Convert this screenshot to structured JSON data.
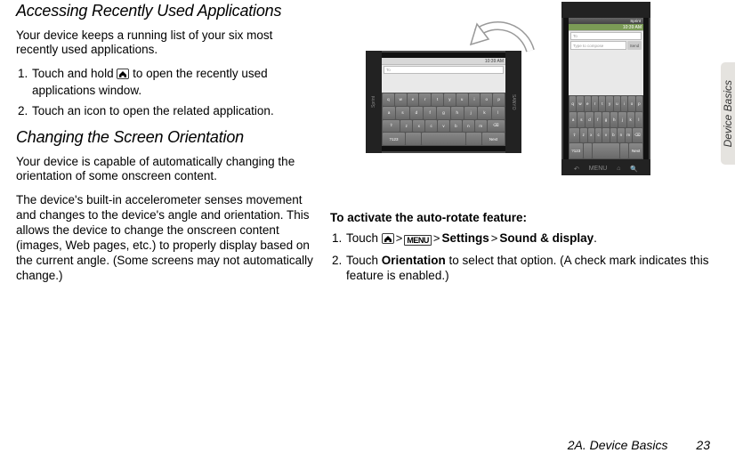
{
  "section1": {
    "title": "Accessing Recently Used Applications",
    "intro": "Your device keeps a running list of your six most recently used applications.",
    "step1": "Touch and hold ",
    "step1b": " to open the recently used applications window.",
    "step2": "Touch an icon to open the related application."
  },
  "section2": {
    "title": "Changing  the Screen Orientation",
    "p1": "Your device is capable of automatically changing the orientation of some onscreen content.",
    "p2": "The device's built-in accelerometer senses movement and changes to the device's angle and orientation. This allows the device to change the onscreen content (images, Web pages, etc.) to properly display based on the current angle. (Some screens may not automatically change.)"
  },
  "right": {
    "subhead": "To activate the auto-rotate feature:",
    "step1_a": "Touch ",
    "step1_settings": "Settings",
    "step1_sound": "Sound & display",
    "step1_end": ".",
    "step2_a": "Touch ",
    "step2_orientation": "Orientation",
    "step2_b": " to select that option. (A check mark indicates this feature is enabled.)"
  },
  "device": {
    "time": "10:39 AM",
    "sprint": "Sprint ",
    "brand": "SANYO",
    "to": "To",
    "compose": "Type to compose",
    "send": "Send",
    "keys_r1": [
      "q",
      "w",
      "e",
      "r",
      "t",
      "y",
      "u",
      "i",
      "o",
      "p"
    ],
    "keys_r2": [
      "a",
      "s",
      "d",
      "f",
      "g",
      "h",
      "j",
      "k",
      "l"
    ],
    "keys_r3": [
      "⇧",
      "z",
      "x",
      "c",
      "v",
      "b",
      "n",
      "m",
      "⌫"
    ],
    "keys_r4_sym": "?123",
    "keys_r4_next": "Next",
    "menu_label": "MENU"
  },
  "sidetab": "Device Basics",
  "footer_chapter": "2A. Device Basics",
  "footer_page": "23",
  "numbers": {
    "one": "1.",
    "two": "2."
  }
}
